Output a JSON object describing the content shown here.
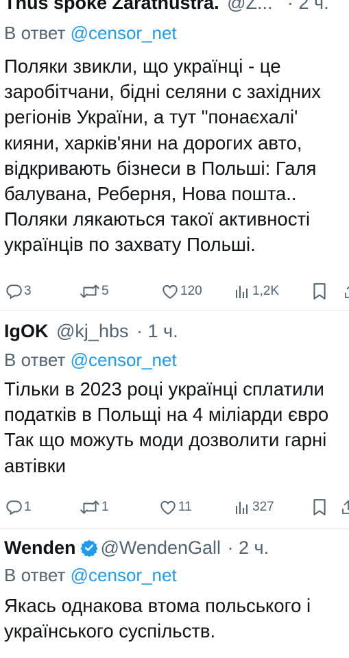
{
  "tweets": [
    {
      "name": "Thus spoke Zarathustra.",
      "handle": "@Z...",
      "time": "· 2 ч.",
      "reply_prefix": "В ответ",
      "reply_to": "@censor_net",
      "lines": [
        "Поляки звикли, що українці - це",
        "заробітчани, бідні селяни с західних",
        "регіонів України, а тут \"понаєхалі'",
        "кияни, харків'яни на дорогих авто,",
        "відкривають бізнеси в Польші: Галя",
        "балувана, Реберня, Нова пошта..",
        "Поляки лякаються такої активності",
        "українців по захвату Польші."
      ],
      "replies": "3",
      "retweets": "5",
      "likes": "120",
      "views": "1,2K"
    },
    {
      "name": "IgOK",
      "handle": "@kj_hbs",
      "time": "· 1 ч.",
      "reply_prefix": "В ответ",
      "reply_to": "@censor_net",
      "lines": [
        "Тільки в 2023 році українці сплатили",
        "податків в Польщі на 4 міліарди євро",
        "Так що можуть моди дозволити гарні",
        "автівки"
      ],
      "replies": "1",
      "retweets": "1",
      "likes": "11",
      "views": "327"
    },
    {
      "name": "Wenden",
      "handle": "@WendenGall",
      "time": "· 2 ч.",
      "reply_prefix": "В ответ",
      "reply_to": "@censor_net",
      "lines": [
        "Якась однакова втома польського і",
        "українського суспільств."
      ]
    }
  ],
  "icons": {
    "reply": "comment-bubble-icon",
    "retweet": "retweet-icon",
    "like": "heart-icon",
    "views": "views-chart-icon",
    "bookmark": "bookmark-icon",
    "share": "share-icon",
    "verified": "verified-badge-icon"
  },
  "colors": {
    "text": "#0f1419",
    "secondary": "#536471",
    "link": "#1d9bf0",
    "verified": "#1d9bf0"
  }
}
